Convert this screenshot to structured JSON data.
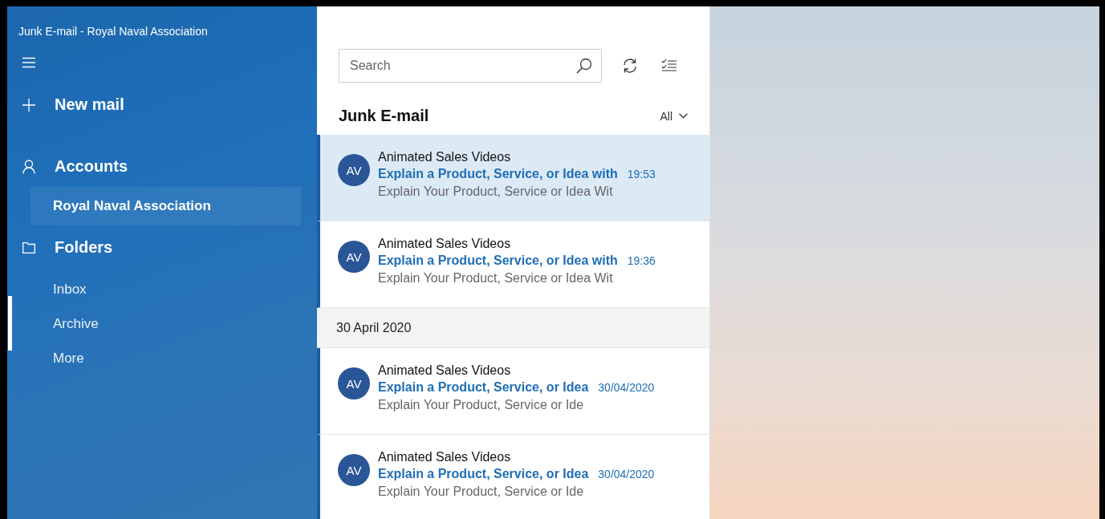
{
  "window": {
    "title": "Junk E-mail - Royal Naval Association"
  },
  "sidebar": {
    "new_mail": "New mail",
    "accounts": {
      "label": "Accounts",
      "items": [
        {
          "label": "Royal Naval Association",
          "selected": true
        }
      ]
    },
    "folders": {
      "label": "Folders",
      "items": [
        {
          "label": "Inbox",
          "selected": false
        },
        {
          "label": "Archive",
          "selected": true
        },
        {
          "label": "More",
          "selected": false
        }
      ]
    }
  },
  "message_list": {
    "search": {
      "placeholder": "Search"
    },
    "folder_title": "Junk E-mail",
    "filter": "All",
    "items": [
      {
        "kind": "message",
        "initials": "AV",
        "sender": "Animated Sales Videos",
        "subject": "Explain a Product, Service, or Idea with",
        "time": "19:53",
        "preview": "Explain Your Product, Service or Idea Wit",
        "selected": true,
        "unread": true
      },
      {
        "kind": "message",
        "initials": "AV",
        "sender": "Animated Sales Videos",
        "subject": "Explain a Product, Service, or Idea with",
        "time": "19:36",
        "preview": "Explain Your Product, Service or Idea Wit",
        "selected": false,
        "unread": true
      },
      {
        "kind": "date-header",
        "label": "30 April 2020"
      },
      {
        "kind": "message",
        "initials": "AV",
        "sender": "Animated Sales Videos",
        "subject": "Explain a Product, Service, or Idea",
        "time": "30/04/2020",
        "preview": "Explain Your Product, Service or Ide",
        "selected": false,
        "unread": true
      },
      {
        "kind": "message",
        "initials": "AV",
        "sender": "Animated Sales Videos",
        "subject": "Explain a Product, Service, or Idea",
        "time": "30/04/2020",
        "preview": "Explain Your Product, Service or Ide",
        "selected": false,
        "unread": true
      }
    ]
  }
}
